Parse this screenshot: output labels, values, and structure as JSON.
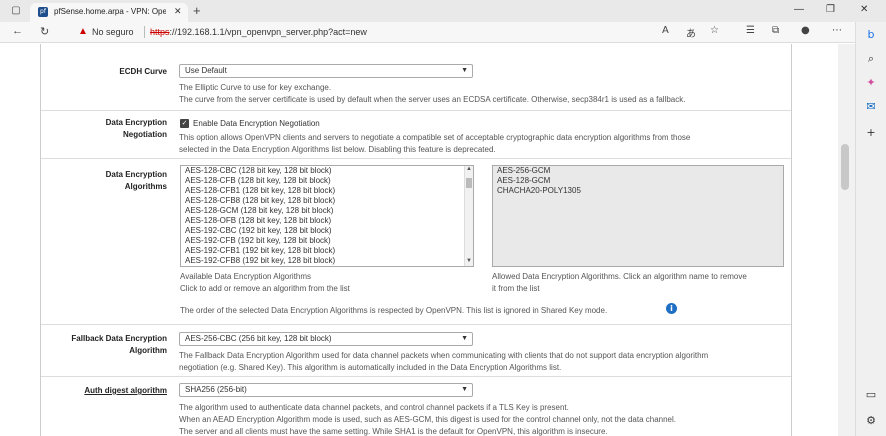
{
  "browser": {
    "tab_title": "pfSense.home.arpa - VPN: OpenVPN",
    "tab_favicon_text": "pf",
    "security_label": "No seguro",
    "url_scheme": "https",
    "url_rest": "://192.168.1.1/vpn_openvpn_server.php?act=new"
  },
  "settings": {
    "ecdh": {
      "label": "ECDH Curve",
      "value": "Use Default",
      "help1": "The Elliptic Curve to use for key exchange.",
      "help2": "The curve from the server certificate is used by default when the server uses an ECDSA certificate. Otherwise, secp384r1 is used as a fallback."
    },
    "negotiation": {
      "label_line1": "Data Encryption",
      "label_line2": "Negotiation",
      "checkbox_label": "Enable Data Encryption Negotiation",
      "checked": true,
      "help1": "This option allows OpenVPN clients and servers to negotiate a compatible set of acceptable cryptographic data encryption algorithms from those",
      "help2": "selected in the Data Encryption Algorithms list below. Disabling this feature is deprecated."
    },
    "algorithms": {
      "label_line1": "Data Encryption",
      "label_line2": "Algorithms",
      "available": [
        "AES-128-CBC (128 bit key, 128 bit block)",
        "AES-128-CFB (128 bit key, 128 bit block)",
        "AES-128-CFB1 (128 bit key, 128 bit block)",
        "AES-128-CFB8 (128 bit key, 128 bit block)",
        "AES-128-GCM (128 bit key, 128 bit block)",
        "AES-128-OFB (128 bit key, 128 bit block)",
        "AES-192-CBC (192 bit key, 128 bit block)",
        "AES-192-CFB (192 bit key, 128 bit block)",
        "AES-192-CFB1 (192 bit key, 128 bit block)",
        "AES-192-CFB8 (192 bit key, 128 bit block)"
      ],
      "allowed": [
        "AES-256-GCM",
        "AES-128-GCM",
        "CHACHA20-POLY1305"
      ],
      "available_help1": "Available Data Encryption Algorithms",
      "available_help2": "Click to add or remove an algorithm from the list",
      "allowed_help1": "Allowed Data Encryption Algorithms. Click an algorithm name to remove",
      "allowed_help2": "it from the list",
      "order_note": "The order of the selected Data Encryption Algorithms is respected by OpenVPN. This list is ignored in Shared Key mode."
    },
    "fallback": {
      "label_line1": "Fallback Data Encryption",
      "label_line2": "Algorithm",
      "value": "AES-256-CBC (256 bit key, 128 bit block)",
      "help1": "The Fallback Data Encryption Algorithm used for data channel packets when communicating with clients that do not support data encryption algorithm",
      "help2": "negotiation (e.g. Shared Key). This algorithm is automatically included in the Data Encryption Algorithms list."
    },
    "auth": {
      "label": "Auth digest algorithm",
      "value": "SHA256 (256-bit)",
      "help1": "The algorithm used to authenticate data channel packets, and control channel packets if a TLS Key is present.",
      "help2": "When an AEAD Encryption Algorithm mode is used, such as AES-GCM, this digest is used for the control channel only, not the data channel.",
      "help3": "The server and all clients must have the same setting. While SHA1 is the default for OpenVPN, this algorithm is insecure."
    }
  }
}
